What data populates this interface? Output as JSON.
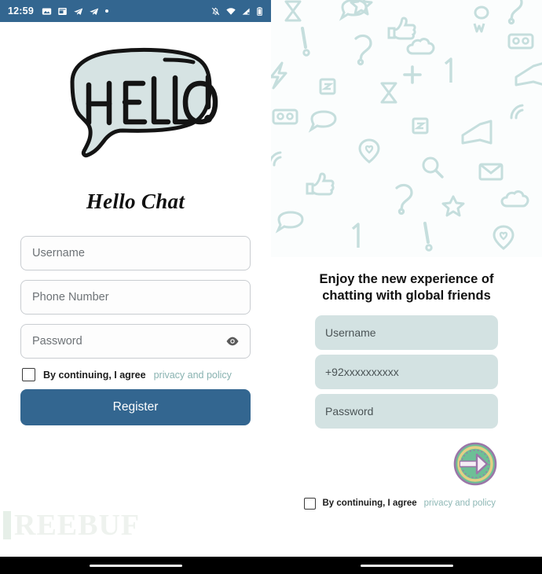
{
  "left_screen": {
    "status_bar": {
      "time": "12:59",
      "bg_color": "#336690",
      "left_icons": [
        "image-icon",
        "news-icon",
        "telegram-icon",
        "telegram-icon",
        "dot-icon"
      ],
      "right_icons": [
        "notifications-off-icon",
        "wifi-icon",
        "mobile-signal-off-icon",
        "battery-icon"
      ]
    },
    "logo": {
      "name": "hello-speech-bubble-logo",
      "text": "HELLO!",
      "fill_color": "#d6e3e3",
      "outline_color": "#111111"
    },
    "brand_title": "Hello Chat",
    "form": {
      "fields": [
        {
          "name": "username-input",
          "placeholder": "Username",
          "value": "",
          "has_eye_toggle": false
        },
        {
          "name": "phone-input",
          "placeholder": "Phone Number",
          "value": "",
          "has_eye_toggle": false
        },
        {
          "name": "password-input",
          "placeholder": "Password",
          "value": "",
          "has_eye_toggle": true
        }
      ],
      "agree_text": "By continuing, I agree",
      "agree_link": "privacy and policy",
      "agree_checked": false,
      "submit_label": "Register",
      "submit_color": "#336690",
      "link_color": "#88b2b0"
    },
    "watermark": "REEBUF"
  },
  "right_screen": {
    "pattern": {
      "name": "doodle-pattern-background",
      "stroke_color": "#b9d7d6",
      "bg_color": "#fbfdfd",
      "motifs": [
        "question-mark",
        "exclamation-mark",
        "speech-bubble",
        "heart-pin",
        "envelope",
        "magnifier",
        "thumbs-up",
        "omg-text",
        "cloud",
        "number-one",
        "plus-sign",
        "megaphone",
        "lightning",
        "star"
      ]
    },
    "tagline": "Enjoy the new experience of chatting with global friends",
    "form": {
      "fields": [
        {
          "name": "username-input",
          "placeholder": "Username",
          "value": ""
        },
        {
          "name": "phone-input",
          "placeholder": "+92xxxxxxxxxx",
          "value": ""
        },
        {
          "name": "password-input",
          "placeholder": "Password",
          "value": ""
        }
      ],
      "field_bg_color": "#d3e2e2",
      "submit_icon": "arrow-right-circle-icon",
      "agree_text": "By continuing, I agree",
      "agree_link": "privacy and policy",
      "agree_checked": false,
      "link_color": "#8fb8b6"
    }
  },
  "nav_bar": {
    "name": "home-indicator",
    "bg_color": "#000000"
  }
}
